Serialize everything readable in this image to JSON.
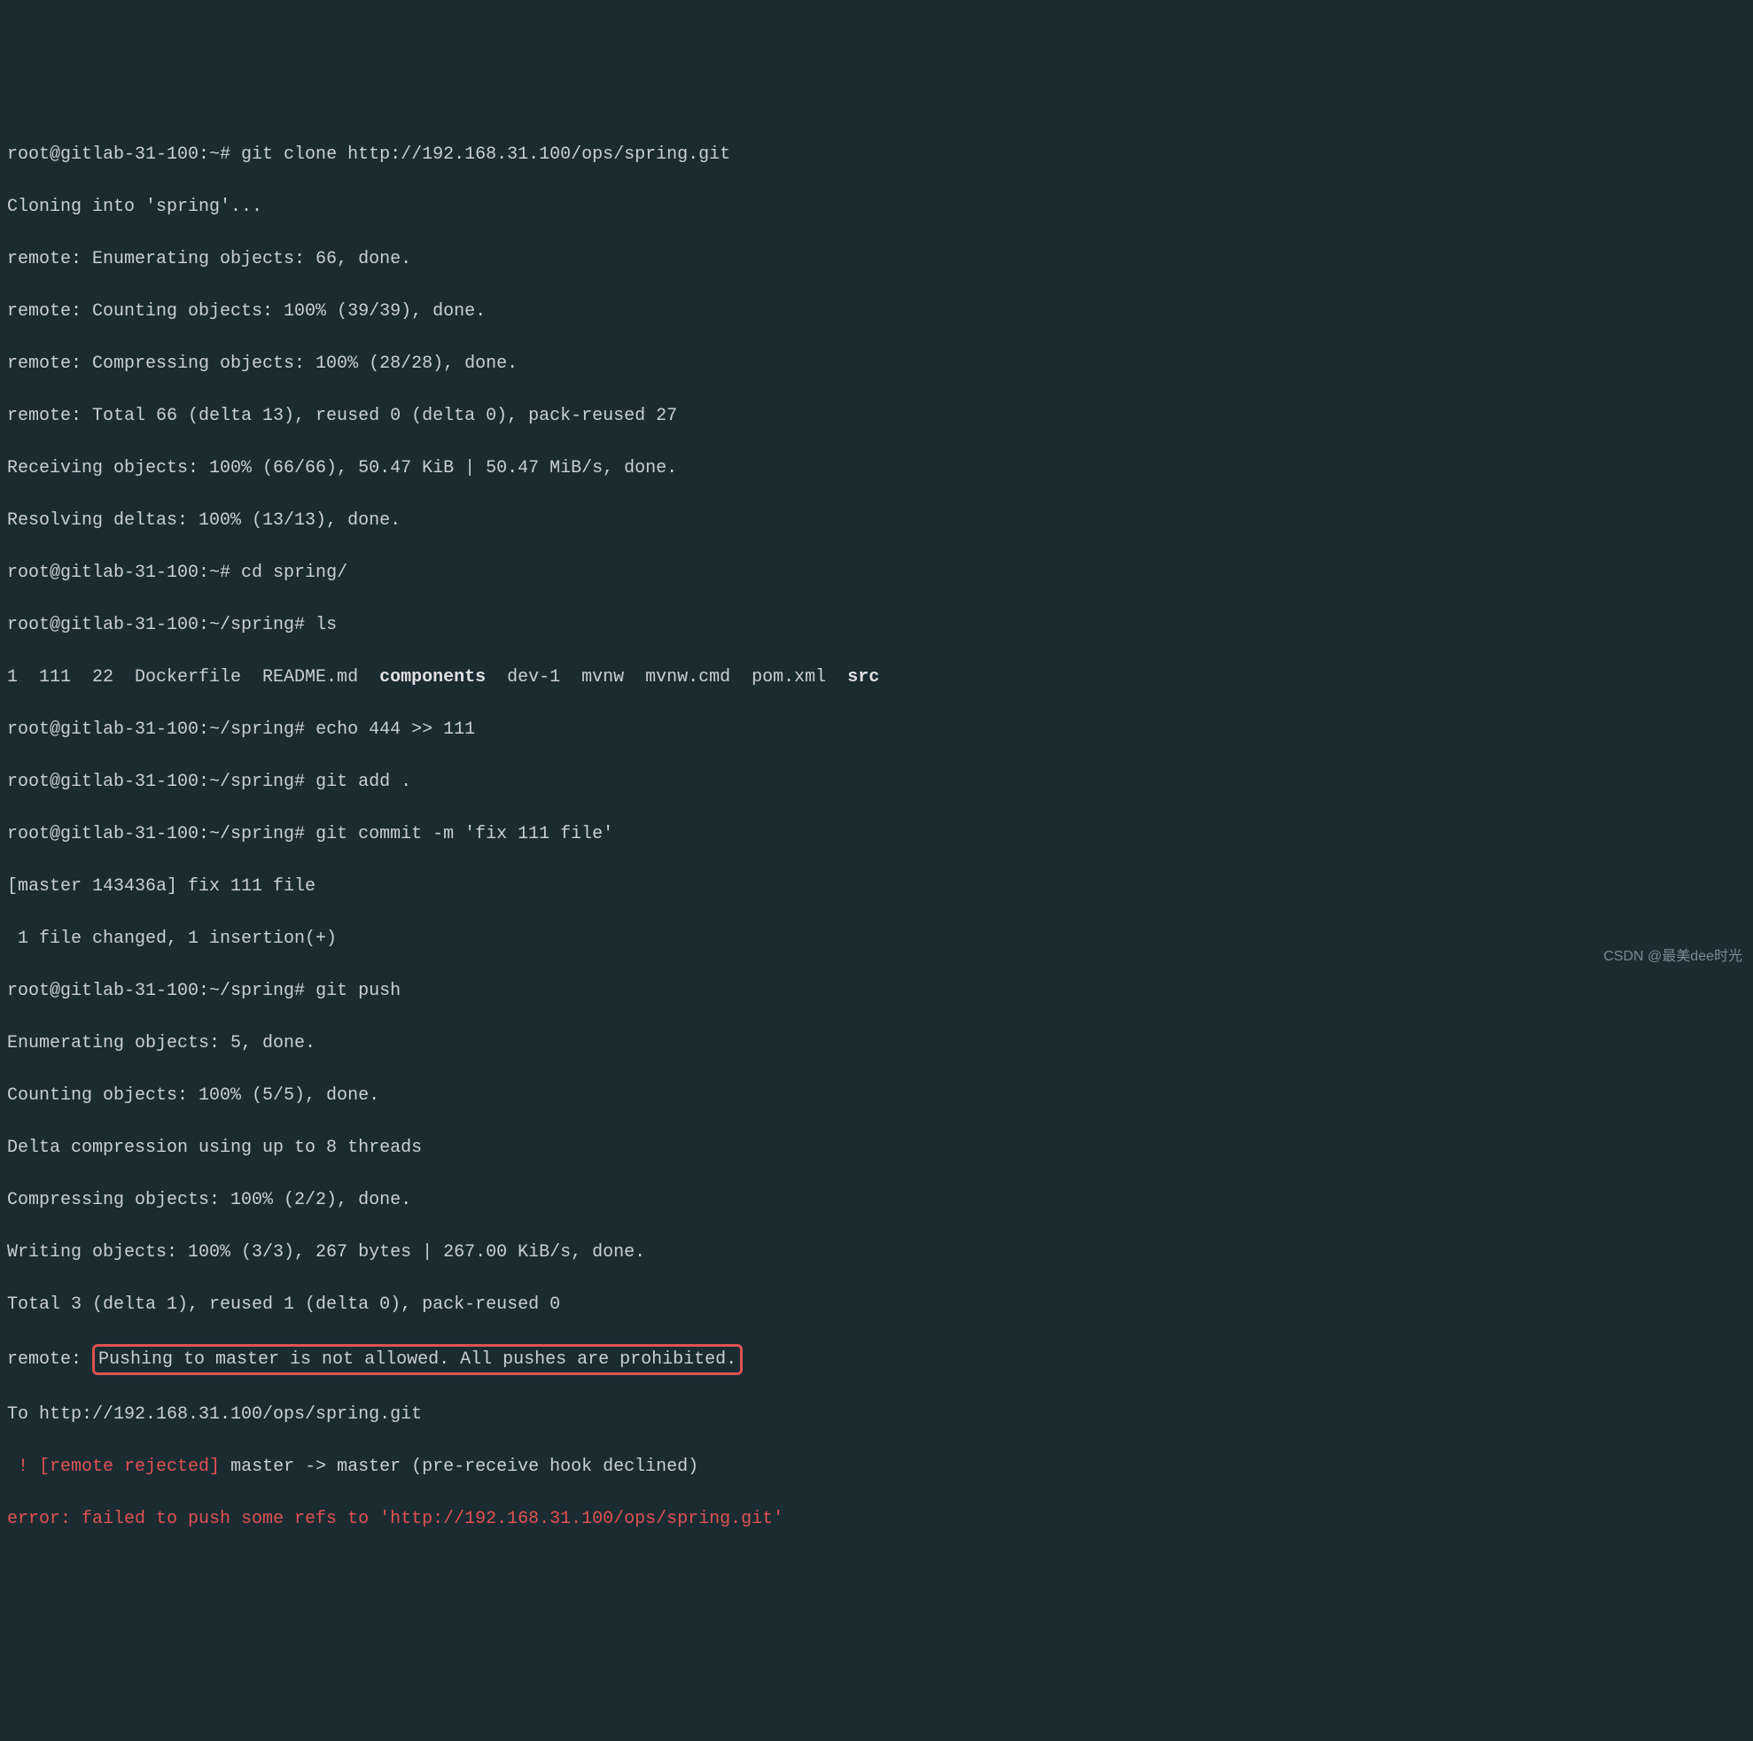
{
  "lines": {
    "l1_prompt": "root@gitlab-31-100:~# ",
    "l1_cmd": "git clone http://192.168.31.100/ops/spring.git",
    "l2": "Cloning into 'spring'...",
    "l3": "remote: Enumerating objects: 66, done.",
    "l4": "remote: Counting objects: 100% (39/39), done.",
    "l5": "remote: Compressing objects: 100% (28/28), done.",
    "l6": "remote: Total 66 (delta 13), reused 0 (delta 0), pack-reused 27",
    "l7": "Receiving objects: 100% (66/66), 50.47 KiB | 50.47 MiB/s, done.",
    "l8": "Resolving deltas: 100% (13/13), done.",
    "l9_prompt": "root@gitlab-31-100:~# ",
    "l9_cmd": "cd spring/",
    "l10_prompt": "root@gitlab-31-100:~/spring# ",
    "l10_cmd": "ls",
    "ls_1": "1  111  22  Dockerfile  README.md  ",
    "ls_components": "components",
    "ls_2": "  dev-1  mvnw  mvnw.cmd  pom.xml  ",
    "ls_src": "src",
    "l12_prompt": "root@gitlab-31-100:~/spring# ",
    "l12_cmd": "echo 444 >> 111",
    "l13_prompt": "root@gitlab-31-100:~/spring# ",
    "l13_cmd": "git add .",
    "l14_prompt": "root@gitlab-31-100:~/spring# ",
    "l14_cmd": "git commit -m 'fix 111 file'",
    "l15": "[master 143436a] fix 111 file",
    "l16": " 1 file changed, 1 insertion(+)",
    "l17_prompt": "root@gitlab-31-100:~/spring# ",
    "l17_cmd": "git push",
    "l18": "Enumerating objects: 5, done.",
    "l19": "Counting objects: 100% (5/5), done.",
    "l20": "Delta compression using up to 8 threads",
    "l21": "Compressing objects: 100% (2/2), done.",
    "l22": "Writing objects: 100% (3/3), 267 bytes | 267.00 KiB/s, done.",
    "l23": "Total 3 (delta 1), reused 1 (delta 0), pack-reused 0",
    "l24_prefix": "remote: ",
    "l24_boxed": "Pushing to master is not allowed. All pushes are prohibited.",
    "l25": "To http://192.168.31.100/ops/spring.git",
    "l26_bang": " ! ",
    "l26_rejected": "[remote rejected]",
    "l26_rest": " master -> master (pre-receive hook declined)",
    "l27": "error: failed to push some refs to 'http://192.168.31.100/ops/spring.git'"
  },
  "watermark": "CSDN @最美dee时光"
}
